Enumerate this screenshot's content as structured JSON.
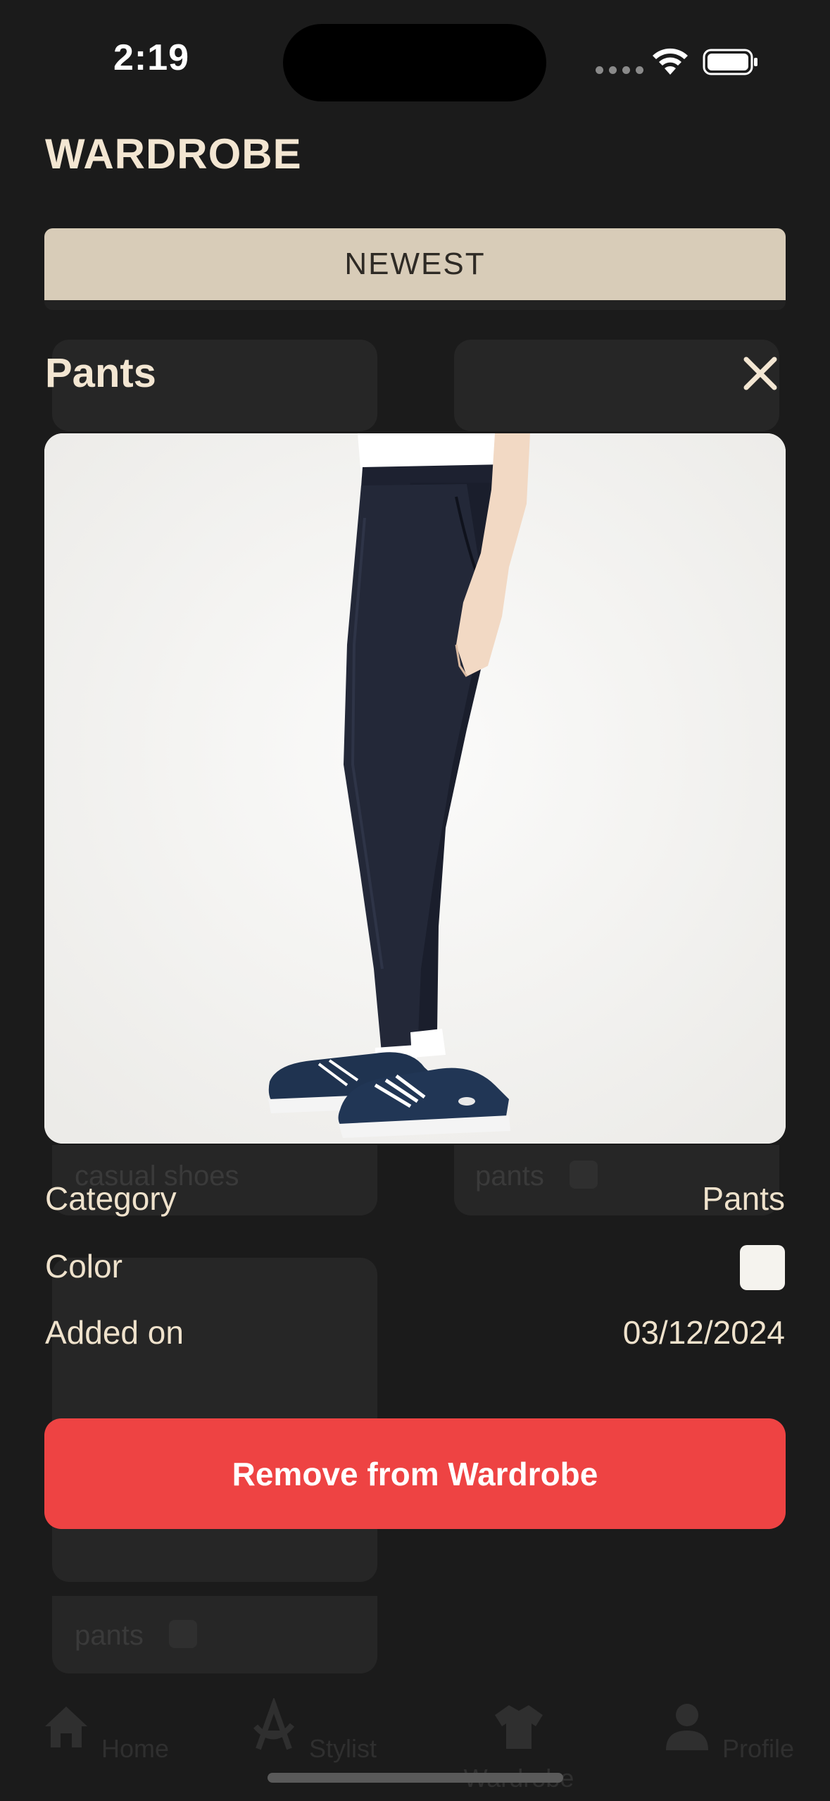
{
  "status_bar": {
    "time": "2:19",
    "icons": [
      "cellular-icon",
      "wifi-icon",
      "battery-icon"
    ]
  },
  "header": {
    "title": "WARDROBE",
    "sort_label": "NEWEST"
  },
  "background_grid": {
    "items": [
      {
        "label": "casual shoes"
      },
      {
        "label": "pants"
      },
      {
        "label": "pants"
      }
    ]
  },
  "modal": {
    "title": "Pants",
    "close_icon": "close-icon",
    "image_alt": "navy chino pants with navy sneakers",
    "details": {
      "category_label": "Category",
      "category_value": "Pants",
      "color_label": "Color",
      "color_value": "#f5f3ee",
      "added_label": "Added on",
      "added_value": "03/12/2024"
    },
    "remove_label": "Remove from Wardrobe"
  },
  "tab_bar": {
    "items": [
      {
        "label": "Home",
        "icon": "home-icon"
      },
      {
        "label": "Stylist",
        "icon": "stylist-icon"
      },
      {
        "label": "Wardrobe",
        "icon": "shirt-icon"
      },
      {
        "label": "Profile",
        "icon": "person-icon"
      }
    ]
  },
  "colors": {
    "background": "#1b1b1b",
    "accent_text": "#f3e6d2",
    "sort_bar": "#d8ccb8",
    "danger": "#ee4343"
  }
}
